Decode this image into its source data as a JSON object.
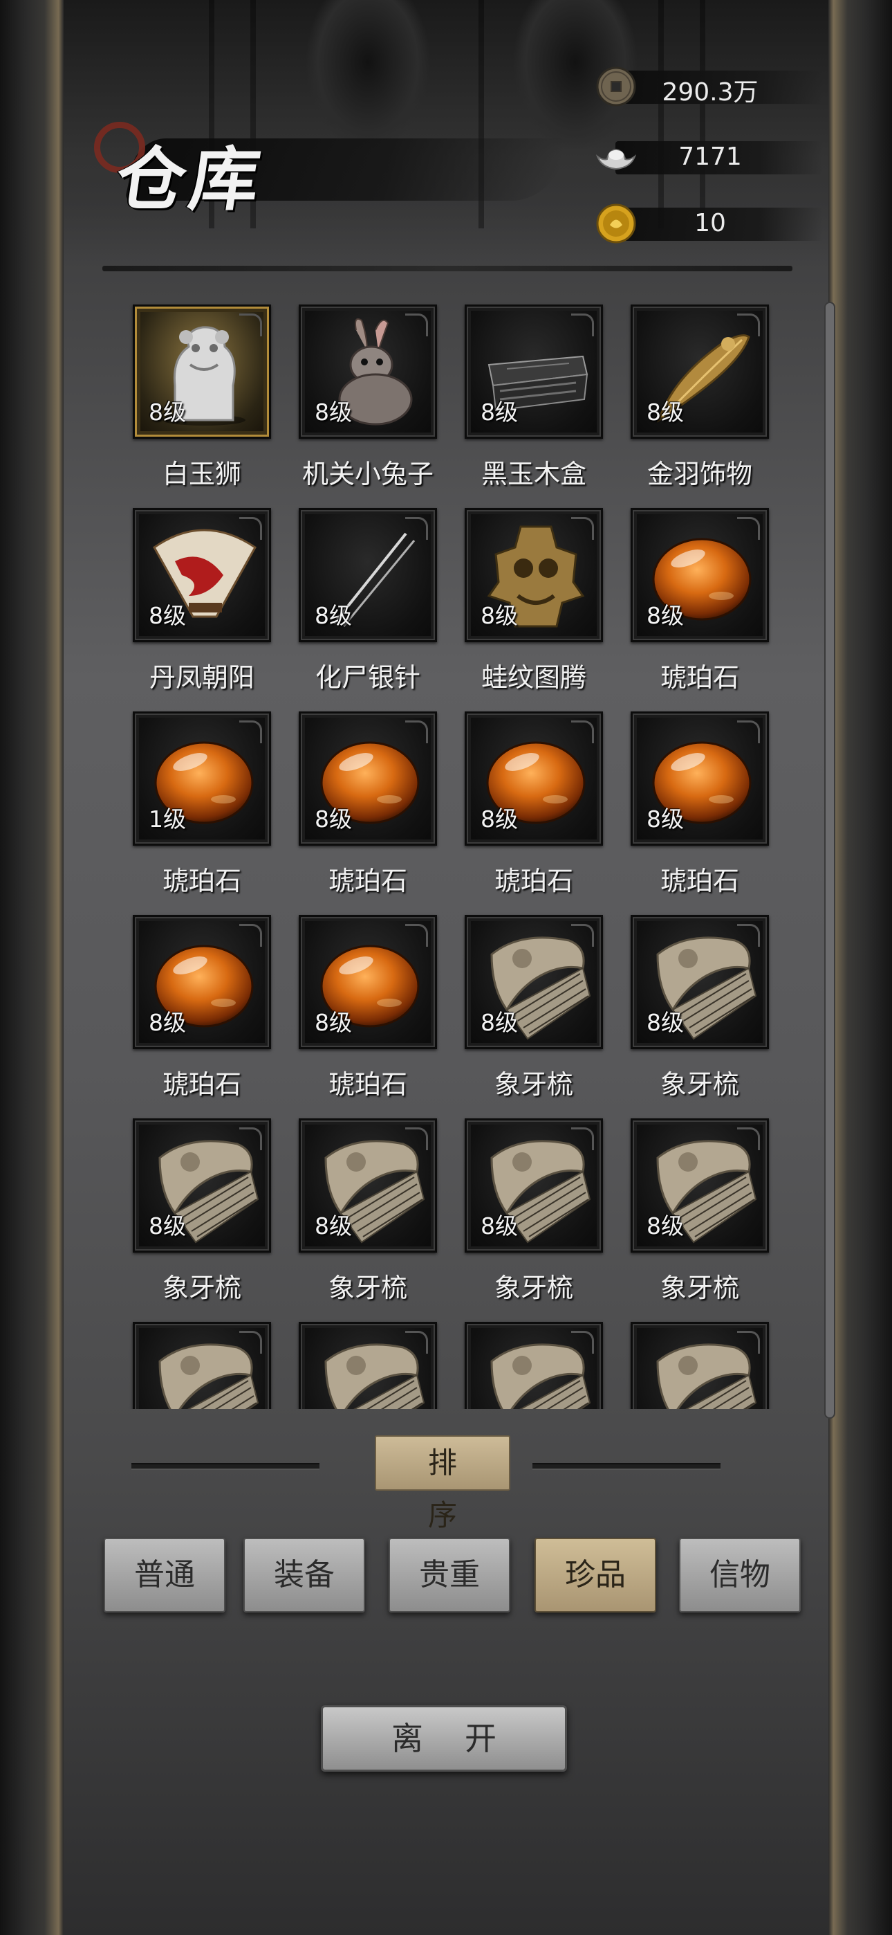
{
  "header": {
    "title": "仓库",
    "currencies": [
      {
        "icon": "copper-coin-icon",
        "value": "290.3万"
      },
      {
        "icon": "silver-ingot-icon",
        "value": "7171"
      },
      {
        "icon": "gold-coin-icon",
        "value": "10"
      }
    ]
  },
  "items": [
    {
      "name": "白玉狮",
      "level": "8级",
      "icon": "jade-lion-icon",
      "rarity": "gold"
    },
    {
      "name": "机关小兔子",
      "level": "8级",
      "icon": "mechanical-rabbit-icon"
    },
    {
      "name": "黑玉木盒",
      "level": "8级",
      "icon": "black-jade-box-icon"
    },
    {
      "name": "金羽饰物",
      "level": "8级",
      "icon": "golden-feather-icon"
    },
    {
      "name": "丹凤朝阳",
      "level": "8级",
      "icon": "phoenix-fan-icon"
    },
    {
      "name": "化尸银针",
      "level": "8级",
      "icon": "silver-needle-icon"
    },
    {
      "name": "蛙纹图腾",
      "level": "8级",
      "icon": "frog-totem-icon"
    },
    {
      "name": "琥珀石",
      "level": "8级",
      "icon": "amber-stone-icon"
    },
    {
      "name": "琥珀石",
      "level": "1级",
      "icon": "amber-stone-icon"
    },
    {
      "name": "琥珀石",
      "level": "8级",
      "icon": "amber-stone-icon"
    },
    {
      "name": "琥珀石",
      "level": "8级",
      "icon": "amber-stone-icon"
    },
    {
      "name": "琥珀石",
      "level": "8级",
      "icon": "amber-stone-icon"
    },
    {
      "name": "琥珀石",
      "level": "8级",
      "icon": "amber-stone-icon"
    },
    {
      "name": "琥珀石",
      "level": "8级",
      "icon": "amber-stone-icon"
    },
    {
      "name": "象牙梳",
      "level": "8级",
      "icon": "ivory-comb-icon"
    },
    {
      "name": "象牙梳",
      "level": "8级",
      "icon": "ivory-comb-icon"
    },
    {
      "name": "象牙梳",
      "level": "8级",
      "icon": "ivory-comb-icon"
    },
    {
      "name": "象牙梳",
      "level": "8级",
      "icon": "ivory-comb-icon"
    },
    {
      "name": "象牙梳",
      "level": "8级",
      "icon": "ivory-comb-icon"
    },
    {
      "name": "象牙梳",
      "level": "8级",
      "icon": "ivory-comb-icon"
    },
    {
      "name": "",
      "level": "",
      "icon": "ivory-comb-icon"
    },
    {
      "name": "",
      "level": "",
      "icon": "ivory-comb-icon"
    },
    {
      "name": "",
      "level": "",
      "icon": "ivory-comb-icon"
    },
    {
      "name": "",
      "level": "",
      "icon": "ivory-comb-icon"
    }
  ],
  "sort": {
    "label": "排序"
  },
  "tabs": [
    {
      "label": "普通",
      "active": false
    },
    {
      "label": "装备",
      "active": false
    },
    {
      "label": "贵重",
      "active": false
    },
    {
      "label": "珍品",
      "active": true
    },
    {
      "label": "信物",
      "active": false
    }
  ],
  "leave": {
    "label": "离开"
  },
  "colors": {
    "accent_gold": "#b28c3a",
    "active_tab": "#c2b08c",
    "amber": "#d86a12"
  }
}
